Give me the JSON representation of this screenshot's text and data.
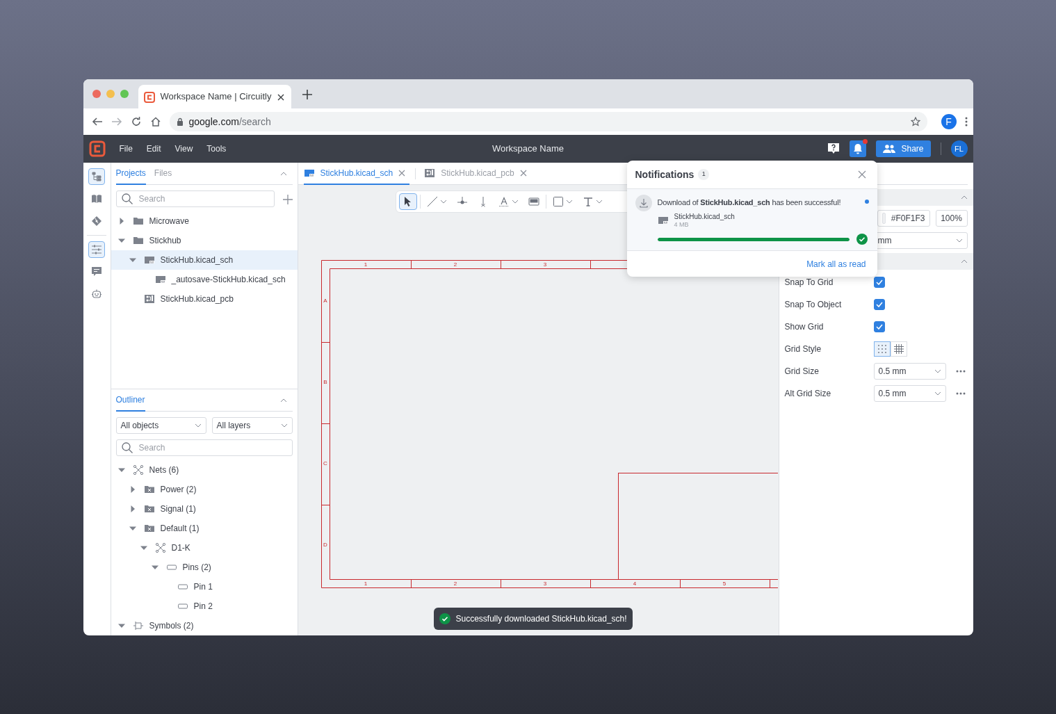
{
  "browser": {
    "tab_title": "Workspace Name | Circuitly",
    "url_host": "google.com",
    "url_path": "/search",
    "profile_initial": "F"
  },
  "app_header": {
    "menu": [
      "File",
      "Edit",
      "View",
      "Tools"
    ],
    "workspace_name": "Workspace Name",
    "notifications_unread": true,
    "share_label": "Share",
    "user_initials": "FL"
  },
  "activity_groups": [
    [
      {
        "kind": "tree",
        "selected": true
      },
      {
        "kind": "book",
        "selected": false
      },
      {
        "kind": "git",
        "selected": false
      }
    ],
    [
      {
        "kind": "sliders",
        "selected": true
      },
      {
        "kind": "comment",
        "selected": false
      },
      {
        "kind": "robot",
        "selected": false
      }
    ]
  ],
  "projects_panel": {
    "tabs": [
      {
        "label": "Projects",
        "selected": true
      },
      {
        "label": "Files",
        "selected": false
      }
    ],
    "search_placeholder": "Search",
    "tree": [
      {
        "label": "Microwave",
        "kind": "folder",
        "expanded": false,
        "selected": false
      },
      {
        "label": "Stickhub",
        "kind": "folder",
        "expanded": true,
        "selected": false,
        "children": [
          {
            "label": "StickHub.kicad_sch",
            "kind": "sch",
            "expanded": true,
            "selected": true,
            "children": [
              {
                "label": "_autosave-StickHub.kicad_sch",
                "kind": "sch",
                "selected": false
              }
            ]
          },
          {
            "label": "StickHub.kicad_pcb",
            "kind": "pcb",
            "selected": false
          }
        ]
      }
    ]
  },
  "outliner": {
    "title": "Outliner",
    "filters": [
      "All objects",
      "All layers"
    ],
    "search_placeholder": "Search",
    "tree": [
      {
        "label": "Nets (6)",
        "kind": "net",
        "expanded": true,
        "selected": false,
        "children": [
          {
            "label": "Power (2)",
            "kind": "netclass",
            "expanded": false,
            "selected": false
          },
          {
            "label": "Signal (1)",
            "kind": "netclass",
            "expanded": false,
            "selected": false
          },
          {
            "label": "Default (1)",
            "kind": "netclass",
            "expanded": true,
            "selected": false,
            "children": [
              {
                "label": "D1-K",
                "kind": "net",
                "expanded": true,
                "selected": false,
                "children": [
                  {
                    "label": "Pins (2)",
                    "kind": "pin",
                    "expanded": true,
                    "selected": false,
                    "children": [
                      {
                        "label": "Pin 1",
                        "kind": "pin",
                        "selected": false
                      },
                      {
                        "label": "Pin 2",
                        "kind": "pin",
                        "selected": false
                      }
                    ]
                  }
                ]
              }
            ]
          }
        ]
      },
      {
        "label": "Symbols (2)",
        "kind": "symbol",
        "expanded": true,
        "selected": false
      }
    ]
  },
  "editor": {
    "tabs": [
      {
        "label": "StickHub.kicad_sch",
        "kind": "sch",
        "selected": true
      },
      {
        "label": "StickHub.kicad_pcb",
        "kind": "pcb",
        "selected": false
      }
    ],
    "toolbar": [
      {
        "kind": "select",
        "selected": true,
        "dropdown": false
      },
      {
        "kind": "line",
        "selected": false,
        "dropdown": true
      },
      {
        "kind": "junction",
        "selected": false,
        "dropdown": false
      },
      {
        "kind": "noconnect",
        "selected": false,
        "dropdown": false
      },
      {
        "kind": "label",
        "selected": false,
        "dropdown": true
      },
      {
        "kind": "image",
        "selected": false,
        "dropdown": false
      },
      {
        "kind": "rect",
        "selected": false,
        "dropdown": true
      },
      {
        "kind": "text",
        "selected": false,
        "dropdown": true
      }
    ],
    "sheet": {
      "top_labels": [
        "1",
        "2",
        "3"
      ],
      "bottom_labels": [
        "1",
        "2",
        "3",
        "4",
        "5"
      ],
      "row_labels": [
        "A",
        "B",
        "C",
        "D"
      ]
    },
    "toast": {
      "message": "Successfully downloaded StickHub.kicad_sch!"
    }
  },
  "properties": {
    "color_value": "#F0F1F3",
    "zoom": "100%",
    "unit_value": "mm",
    "settings": [
      {
        "kind": "checkbox",
        "label": "Snap To Grid",
        "checked": true
      },
      {
        "kind": "checkbox",
        "label": "Snap To Object",
        "checked": true
      },
      {
        "kind": "checkbox",
        "label": "Show Grid",
        "checked": true
      },
      {
        "kind": "segmented",
        "label": "Grid Style",
        "options": [
          {
            "kind": "dots",
            "selected": true
          },
          {
            "kind": "lines",
            "selected": false
          }
        ]
      },
      {
        "kind": "select",
        "label": "Grid Size",
        "value": "0.5 mm"
      },
      {
        "kind": "select",
        "label": "Alt Grid Size",
        "value": "0.5 mm"
      }
    ]
  },
  "notifications": {
    "title": "Notifications",
    "count": "1",
    "items": [
      {
        "message": "Download of **StickHub.kicad_sch** has been successful!",
        "unread": true,
        "file_name": "StickHub.kicad_sch",
        "file_size": "4 MB",
        "level": 1,
        "complete": true
      }
    ],
    "mark_all_label": "Mark all as read"
  }
}
